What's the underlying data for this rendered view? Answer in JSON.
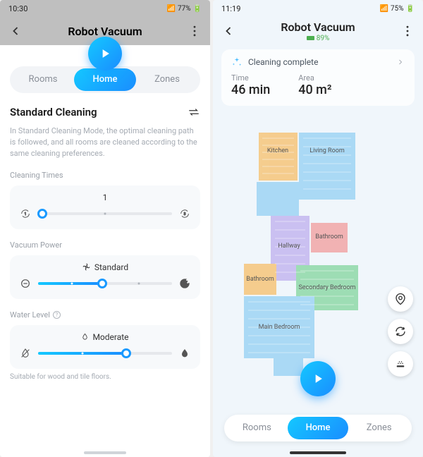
{
  "left": {
    "statusbar": {
      "time": "10:30",
      "battery": "77%"
    },
    "header": {
      "title": "Robot Vacuum"
    },
    "tabs": {
      "rooms": "Rooms",
      "home": "Home",
      "zones": "Zones"
    },
    "mode": {
      "title": "Standard Cleaning",
      "desc": "In Standard Cleaning Mode, the optimal cleaning path is followed, and all rooms are cleaned according to the same cleaning preferences."
    },
    "cleaning_times": {
      "label": "Cleaning Times",
      "value": "1"
    },
    "vacuum_power": {
      "label": "Vacuum Power",
      "value": "Standard"
    },
    "water_level": {
      "label": "Water Level",
      "value": "Moderate",
      "note": "Suitable for wood and tile floors."
    }
  },
  "right": {
    "statusbar": {
      "time": "11:19",
      "battery": "75%"
    },
    "header": {
      "title": "Robot Vacuum",
      "battery_level": "89%"
    },
    "status_card": {
      "status": "Cleaning complete",
      "time_label": "Time",
      "time_value": "46 min",
      "area_label": "Area",
      "area_value": "40 m²"
    },
    "rooms": {
      "kitchen": "Kitchen",
      "living_room": "Living Room",
      "hallway": "Hallway",
      "bathroom1": "Bathroom",
      "bathroom2": "Bathroom",
      "secondary_bedroom": "Secondary Bedroom",
      "main_bedroom": "Main Bedroom"
    },
    "tabs": {
      "rooms": "Rooms",
      "home": "Home",
      "zones": "Zones"
    }
  }
}
